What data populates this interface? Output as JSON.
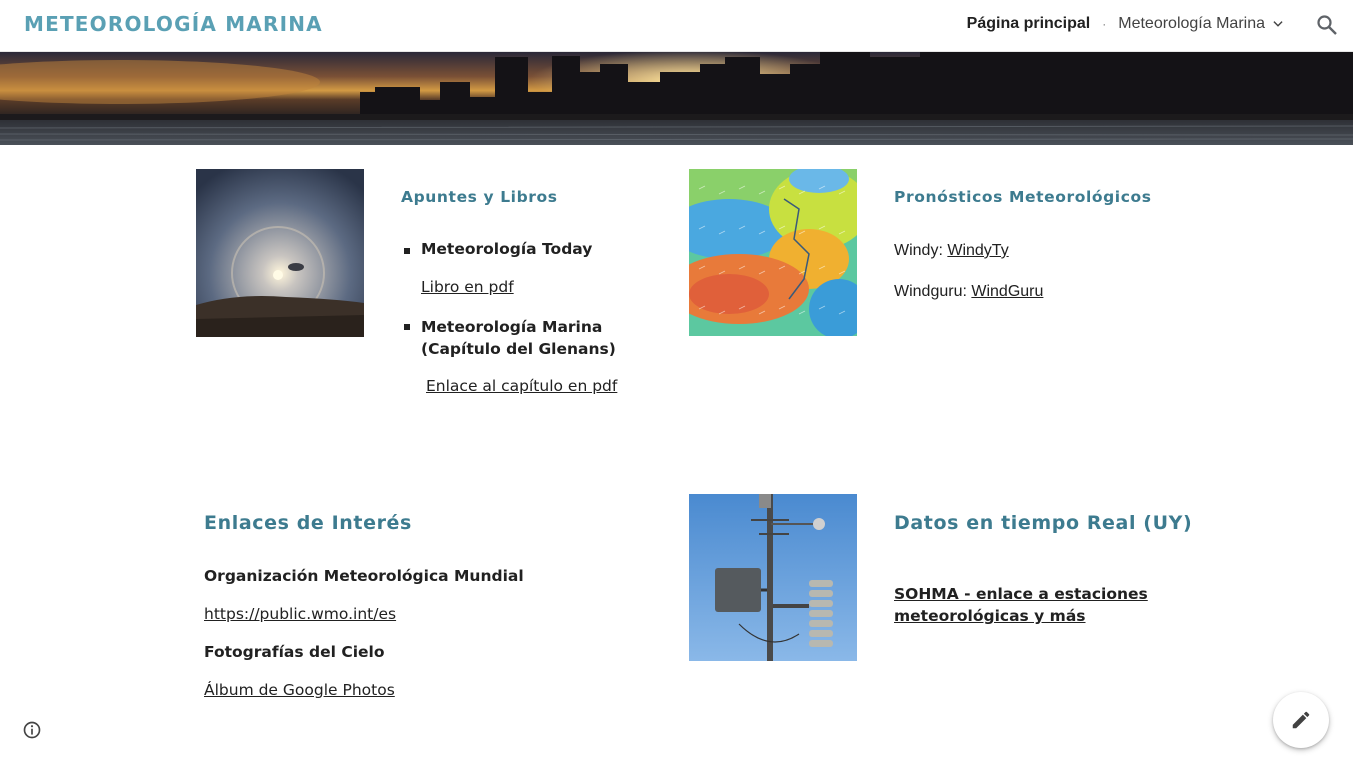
{
  "header": {
    "site_title": "METEOROLOGÍA MARINA",
    "nav_home": "Página principal",
    "nav_separator": "·",
    "nav_sub": "Meteorología Marina"
  },
  "sections": {
    "apuntes": {
      "title": "Apuntes y Libros",
      "item1_title": "Meteorología Today",
      "item1_link": "Libro en pdf",
      "item2_title": "Meteorología Marina (Capítulo del Glenans)",
      "item2_link": "Enlace al capítulo en pdf"
    },
    "pronosticos": {
      "title": "Pronósticos Meteorológicos",
      "row1_label": "Windy: ",
      "row1_link": "WindyTy",
      "row2_label": "Windguru: ",
      "row2_link": "WindGuru"
    },
    "enlaces": {
      "title": "Enlaces de Interés",
      "org_title": "Organización Meteorológica Mundial",
      "org_link": "https://public.wmo.int/es",
      "photos_title": "Fotografías del Cielo",
      "photos_link": "Álbum de Google Photos"
    },
    "datos": {
      "title": "Datos en tiempo Real (UY)",
      "link": "SOHMA - enlace a estaciones meteorológicas y más"
    }
  },
  "icons": {
    "search": "search-icon",
    "chevron": "chevron-down-icon",
    "info": "info-icon",
    "edit": "pencil-icon"
  },
  "colors": {
    "title": "#5aa0b4",
    "heading": "#3d7b8f"
  }
}
